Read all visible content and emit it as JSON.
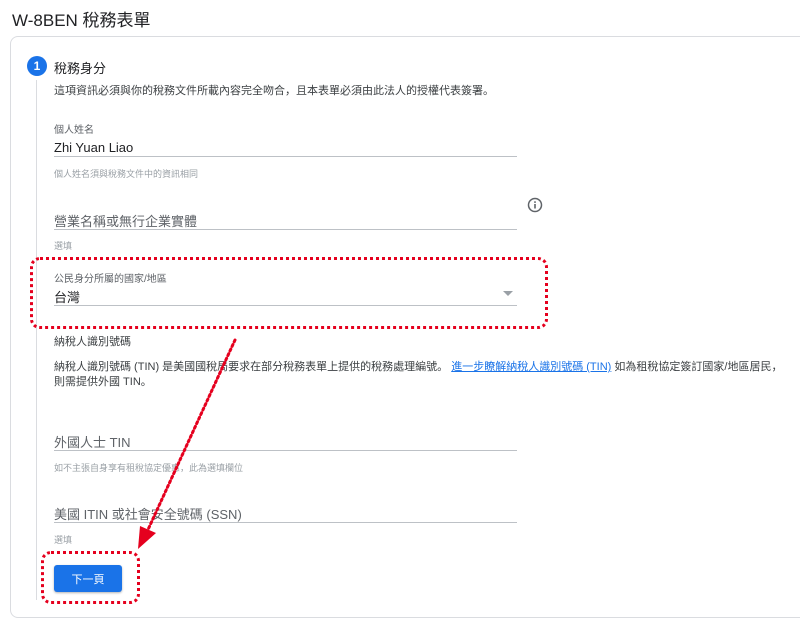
{
  "page": {
    "title": "W-8BEN 稅務表單"
  },
  "section": {
    "step_number": "1",
    "title": "稅務身分",
    "description": "這項資訊必須與你的稅務文件所載內容完全吻合，且本表單必須由此法人的授權代表簽署。"
  },
  "fields": {
    "individual_name": {
      "label": "個人姓名",
      "value": "Zhi Yuan Liao",
      "helper": "個人姓名須與稅務文件中的資訊相同"
    },
    "business_name": {
      "placeholder": "營業名稱或無行企業實體",
      "helper": "選填"
    },
    "citizenship_country": {
      "label": "公民身分所屬的國家/地區",
      "value": "台灣"
    },
    "tin_section": {
      "heading": "納稅人識別號碼",
      "desc_before": "納稅人識別號碼 (TIN) 是美國國稅局要求在部分稅務表單上提供的稅務處理編號。",
      "link": "進一步瞭解納稅人識別號碼 (TIN)",
      "desc_after": " 如為租稅協定簽訂國家/地區居民，則需提供外國 TIN。"
    },
    "foreign_tin": {
      "placeholder": "外國人士 TIN",
      "helper": "如不主張自身享有租稅協定優惠，此為選填欄位"
    },
    "us_itin_ssn": {
      "placeholder": "美國 ITIN 或社會安全號碼 (SSN)",
      "helper": "選填"
    }
  },
  "actions": {
    "next_label": "下一頁"
  },
  "colors": {
    "accent": "#1a73e8",
    "annotation": "#e5001e"
  }
}
